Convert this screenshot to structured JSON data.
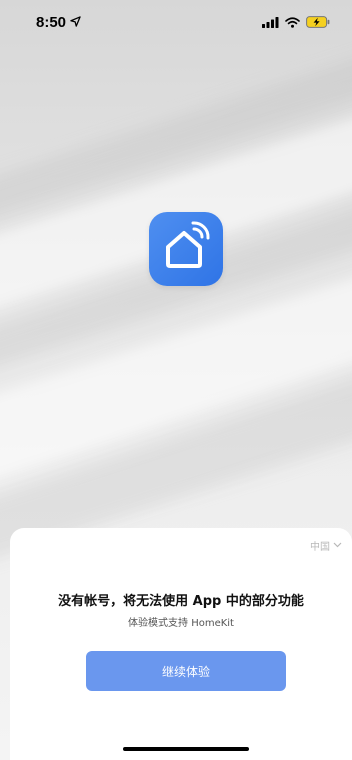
{
  "status_bar": {
    "time": "8:50",
    "icons": [
      "location-arrow-icon",
      "signal-icon",
      "wifi-icon",
      "battery-charging-icon"
    ]
  },
  "app": {
    "logo_icon": "smart-home-icon",
    "accent_color": "#3b7ff0"
  },
  "sheet": {
    "region": "中国",
    "headline": "没有帐号，将无法使用 App 中的部分功能",
    "subline": "体验模式支持 HomeKit",
    "continue_label": "继续体验",
    "button_color": "#6a97ee"
  }
}
